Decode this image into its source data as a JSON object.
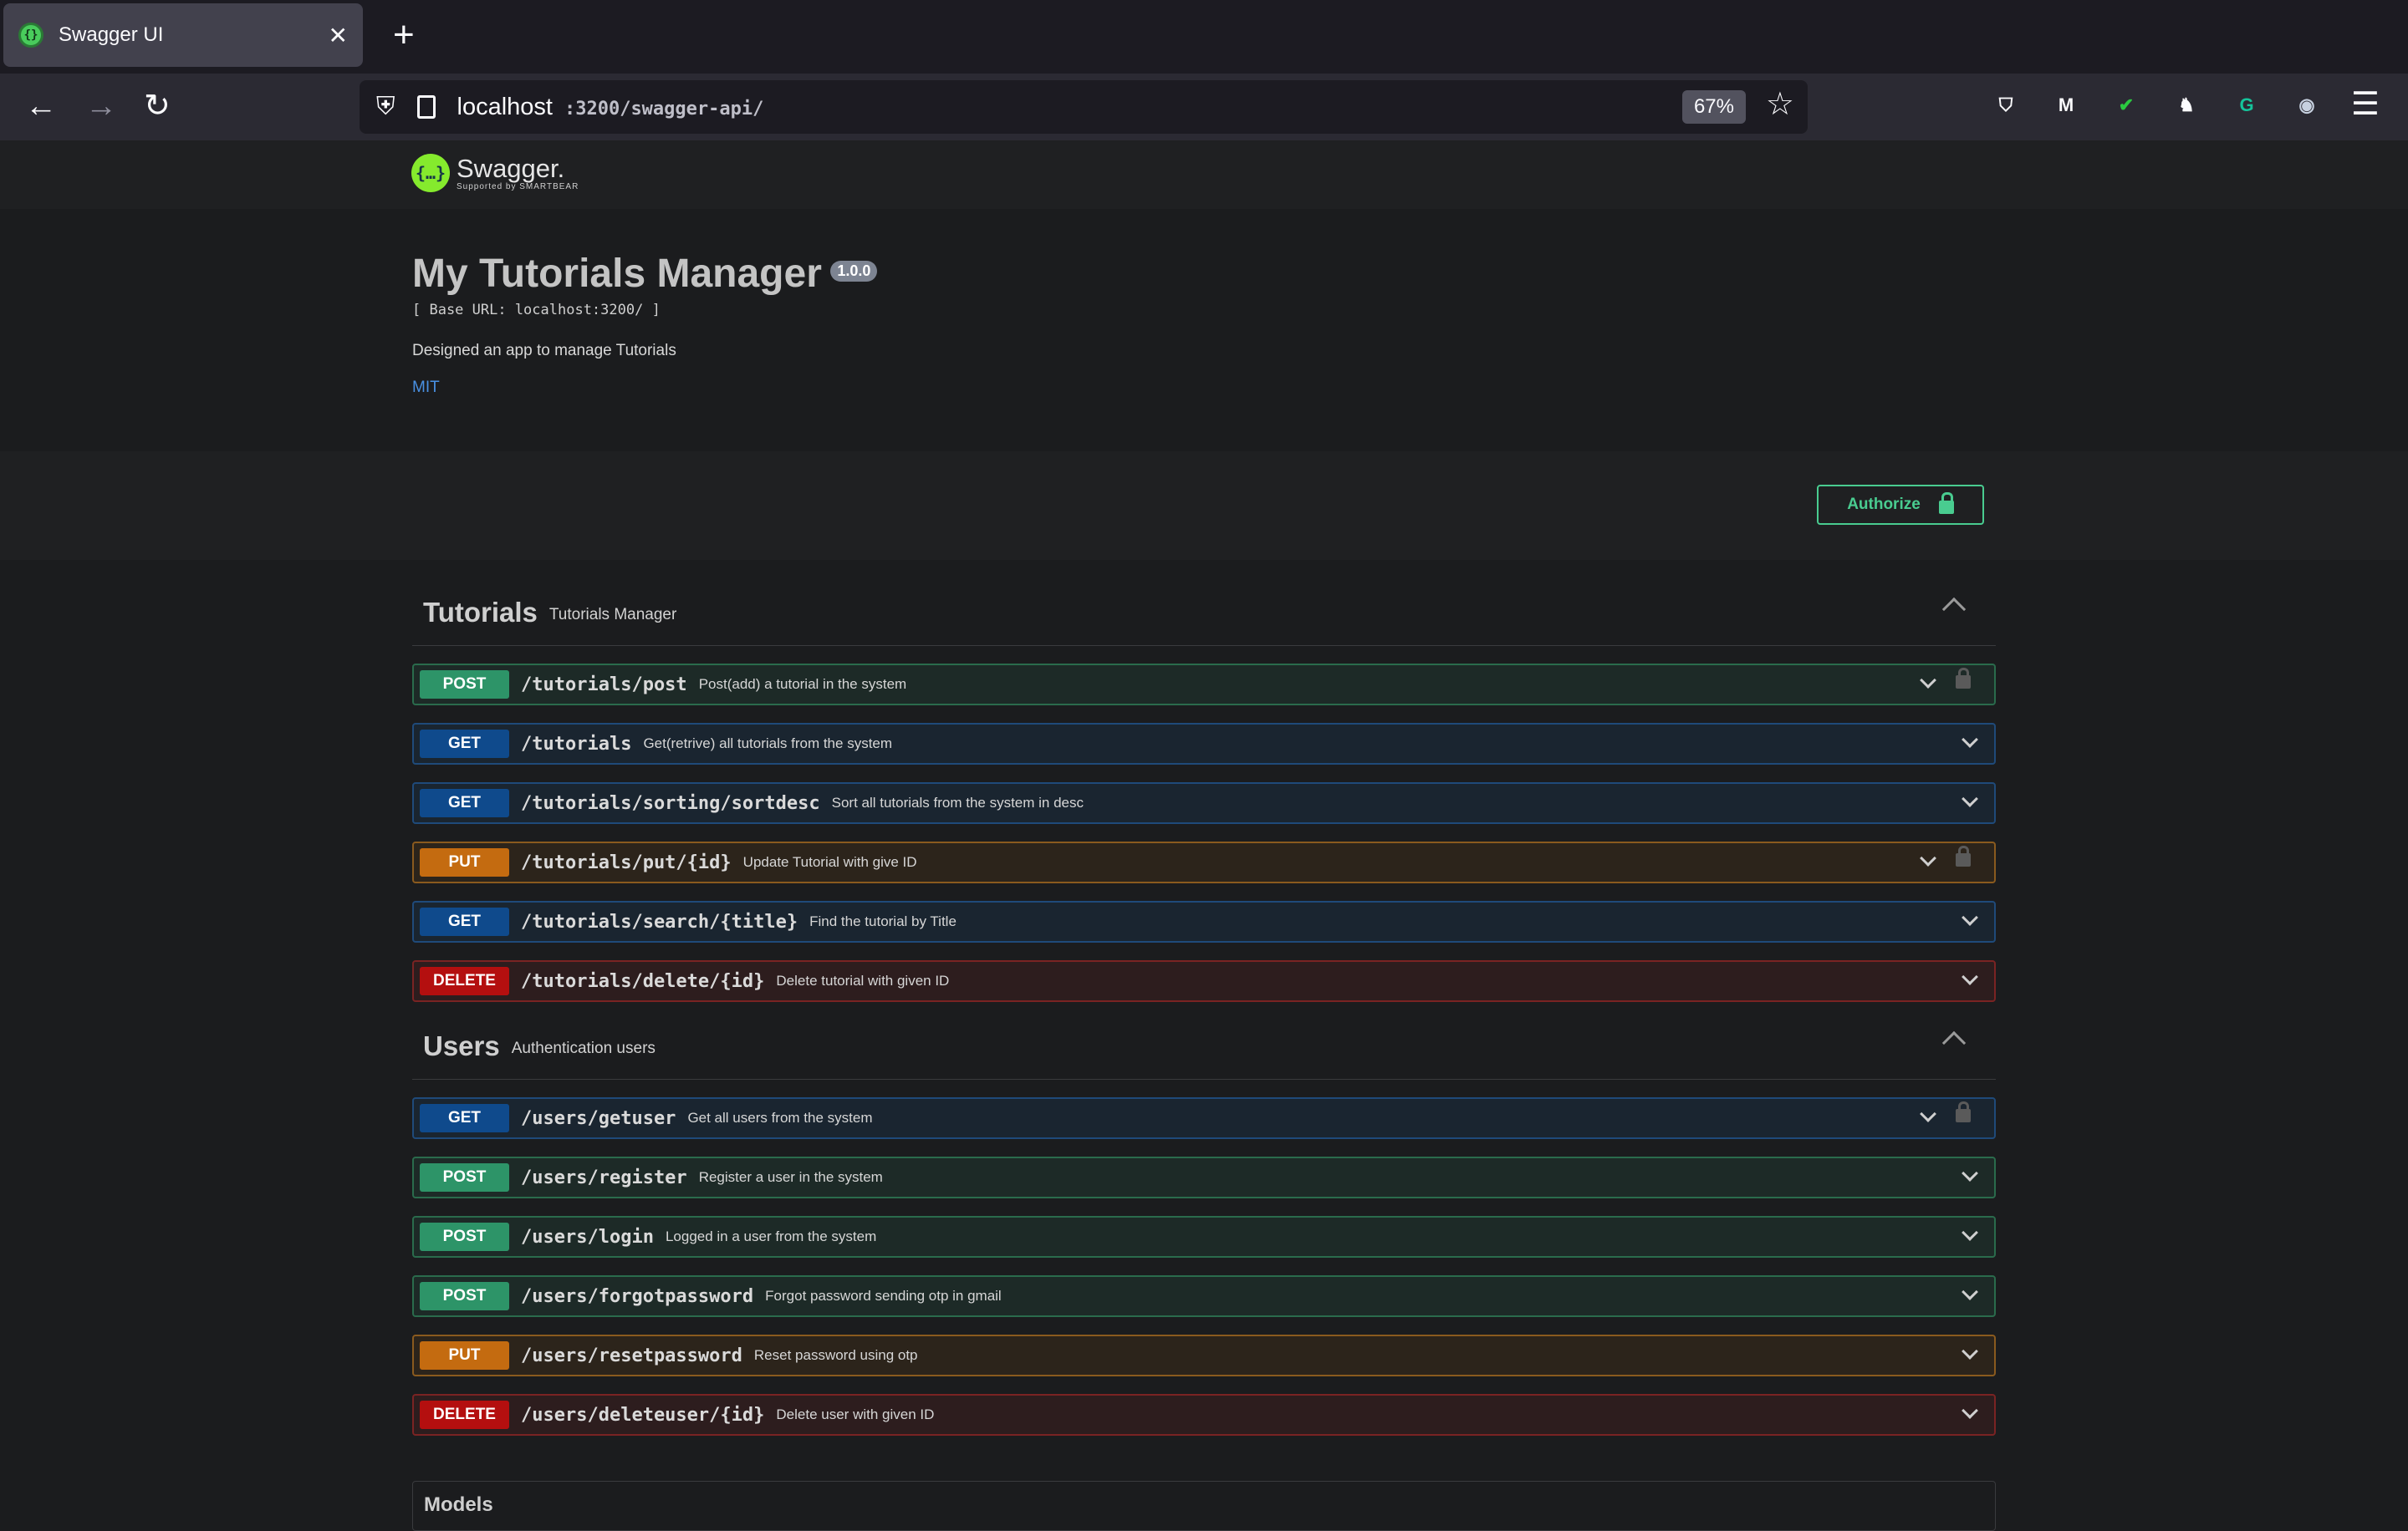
{
  "browser": {
    "tab_title": "Swagger UI",
    "tab_close": "✕",
    "new_tab": "+",
    "url_host": "localhost",
    "url_path": ":3200/swagger-api/",
    "zoom": "67%",
    "back": "←",
    "forward": "→",
    "reload": "↻",
    "star": "☆",
    "menu": "☰",
    "extensions": [
      {
        "icon": "pocket-icon",
        "glyph": "⛉",
        "color": "#fbfbfe"
      },
      {
        "icon": "m-extension-icon",
        "glyph": "M",
        "color": "#fbfbfe"
      },
      {
        "icon": "shield-check-icon",
        "glyph": "✔",
        "color": "#2ac840"
      },
      {
        "icon": "gnome-icon",
        "glyph": "♞",
        "color": "#fbfbfe"
      },
      {
        "icon": "grammarly-icon",
        "glyph": "G",
        "color": "#15c39a"
      },
      {
        "icon": "spy-glasses-icon",
        "glyph": "◉",
        "color": "#c7d1e0"
      }
    ]
  },
  "swagger": {
    "logo_text": "Swagger.",
    "logo_sub": "Supported by SMARTBEAR",
    "logo_glyph": "{…}",
    "title": "My Tutorials Manager",
    "version": "1.0.0",
    "base_url": "[ Base URL: localhost:3200/ ]",
    "description": "Designed an app to manage Tutorials",
    "license": "MIT",
    "authorize_label": "Authorize",
    "colors": {
      "post": "#49cc90",
      "get": "#61affe",
      "put": "#fca130",
      "delete": "#f93e3e"
    },
    "tags": [
      {
        "name": "Tutorials",
        "description": "Tutorials Manager",
        "operations": [
          {
            "method": "POST",
            "path": "/tutorials/post",
            "summary": "Post(add) a tutorial in the system",
            "locked": true
          },
          {
            "method": "GET",
            "path": "/tutorials",
            "summary": "Get(retrive) all tutorials from the system",
            "locked": false
          },
          {
            "method": "GET",
            "path": "/tutorials/sorting/sortdesc",
            "summary": "Sort all tutorials from the system in desc",
            "locked": false
          },
          {
            "method": "PUT",
            "path": "/tutorials/put/{id}",
            "summary": "Update Tutorial with give ID",
            "locked": true
          },
          {
            "method": "GET",
            "path": "/tutorials/search/{title}",
            "summary": "Find the tutorial by Title",
            "locked": false
          },
          {
            "method": "DELETE",
            "path": "/tutorials/delete/{id}",
            "summary": "Delete tutorial with given ID",
            "locked": false
          }
        ]
      },
      {
        "name": "Users",
        "description": "Authentication users",
        "operations": [
          {
            "method": "GET",
            "path": "/users/getuser",
            "summary": "Get all users from the system",
            "locked": true
          },
          {
            "method": "POST",
            "path": "/users/register",
            "summary": "Register a user in the system",
            "locked": false
          },
          {
            "method": "POST",
            "path": "/users/login",
            "summary": "Logged in a user from the system",
            "locked": false
          },
          {
            "method": "POST",
            "path": "/users/forgotpassword",
            "summary": "Forgot password sending otp in gmail",
            "locked": false
          },
          {
            "method": "PUT",
            "path": "/users/resetpassword",
            "summary": "Reset password using otp",
            "locked": false
          },
          {
            "method": "DELETE",
            "path": "/users/deleteuser/{id}",
            "summary": "Delete user with given ID",
            "locked": false
          }
        ]
      }
    ],
    "models_label": "Models"
  }
}
